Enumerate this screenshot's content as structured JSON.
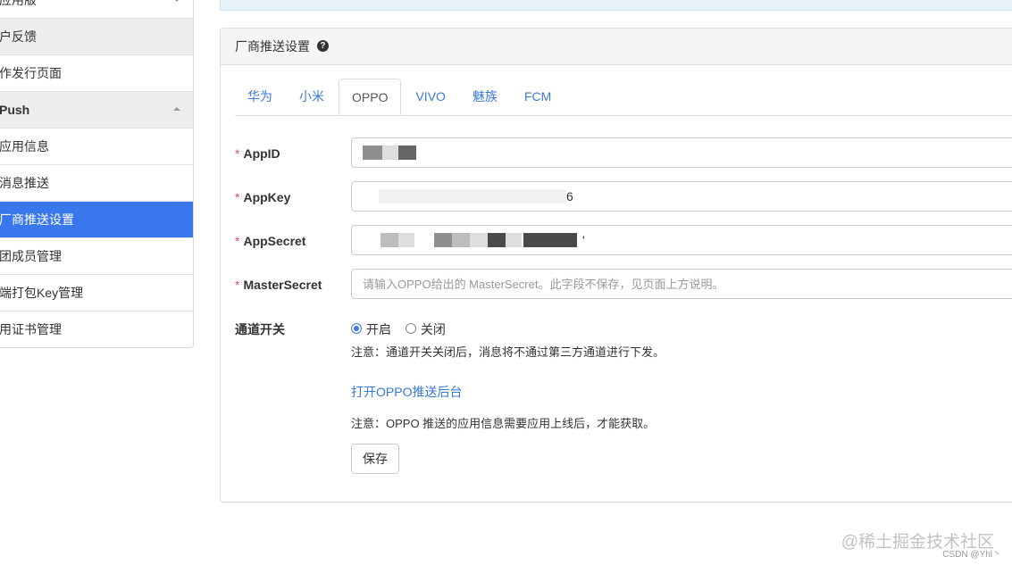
{
  "sidebar": {
    "items": [
      {
        "label": "应用版"
      },
      {
        "label": "户反馈"
      },
      {
        "label": "作发行页面"
      },
      {
        "label": "Push"
      },
      {
        "label": "应用信息"
      },
      {
        "label": "消息推送"
      },
      {
        "label": "厂商推送设置"
      },
      {
        "label": "团成员管理"
      },
      {
        "label": "端打包Key管理"
      },
      {
        "label": "用证书管理"
      }
    ]
  },
  "panel": {
    "title": "厂商推送设置",
    "help_icon": "?"
  },
  "tabs": [
    {
      "label": "华为"
    },
    {
      "label": "小米"
    },
    {
      "label": "OPPO"
    },
    {
      "label": "VIVO"
    },
    {
      "label": "魅族"
    },
    {
      "label": "FCM"
    }
  ],
  "form": {
    "required_mark": "*",
    "appid_label": "AppID",
    "appid_value": "",
    "appkey_label": "AppKey",
    "appkey_value": "6",
    "appsecret_label": "AppSecret",
    "appsecret_value": "'",
    "mastersecret_label": "MasterSecret",
    "mastersecret_value": "",
    "mastersecret_placeholder": "请输入OPPO给出的 MasterSecret。此字段不保存，见页面上方说明。",
    "channel_label": "通道开关",
    "channel_on": "开启",
    "channel_off": "关闭",
    "channel_note": "注意：通道开关关闭后，消息将不通过第三方通道进行下发。",
    "backend_link": "打开OPPO推送后台",
    "info_note": "注意：OPPO 推送的应用信息需要应用上线后，才能获取。",
    "save_label": "保存"
  },
  "watermark": {
    "main": "@稀土掘金技术社区",
    "sub": "CSDN @Yhl丶"
  },
  "colors": {
    "accent": "#3878ec",
    "link": "#3878d8",
    "required": "#d9534f"
  }
}
